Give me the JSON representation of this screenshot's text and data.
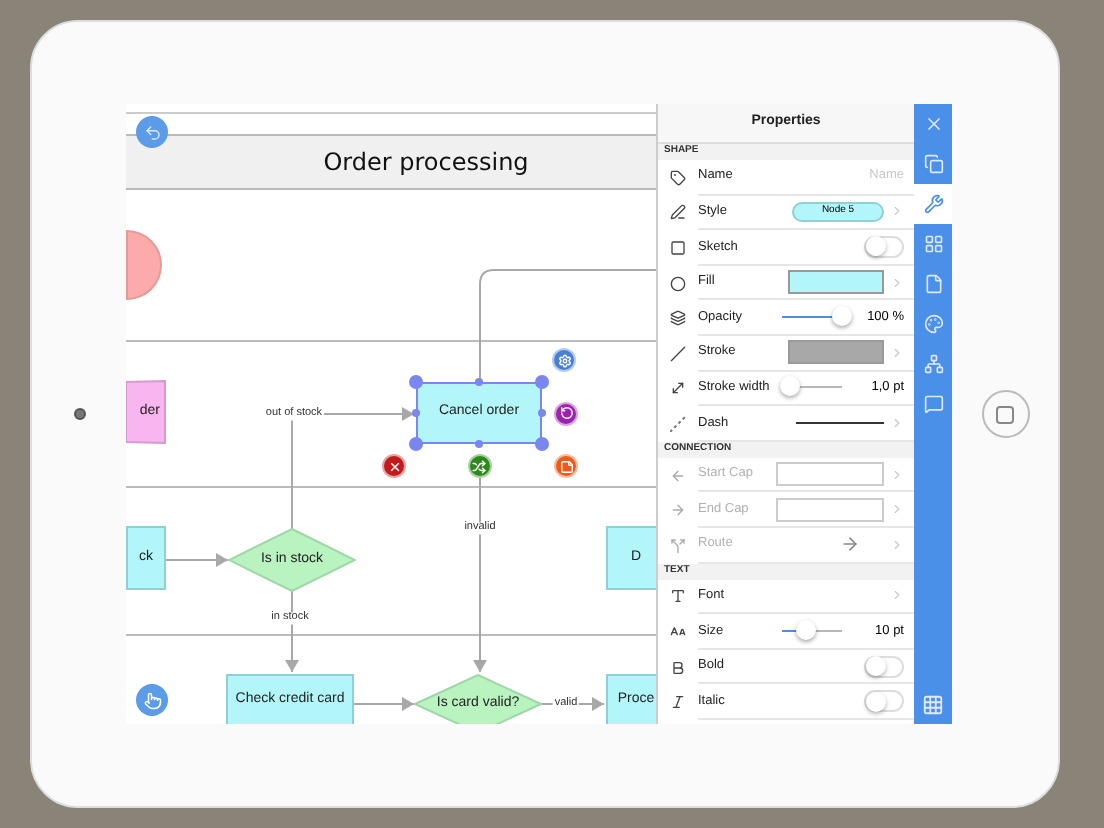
{
  "canvas": {
    "title": "Order processing",
    "nodes": [
      {
        "kind": "manual",
        "text": "der",
        "selected": false
      },
      {
        "kind": "process",
        "text": "Cancel order",
        "selected": true
      },
      {
        "kind": "process",
        "text": "ck",
        "selected": false
      },
      {
        "kind": "decision",
        "text": "Is in stock",
        "selected": false
      },
      {
        "kind": "process",
        "text": "D",
        "selected": false
      },
      {
        "kind": "process",
        "text": "Check credit card",
        "selected": false
      },
      {
        "kind": "decision",
        "text": "Is card valid?",
        "selected": false
      },
      {
        "kind": "process",
        "text": "Proce",
        "selected": false
      }
    ],
    "edge_labels": [
      "out of stock",
      "invalid",
      "in stock",
      "valid"
    ]
  },
  "panel": {
    "title": "Properties",
    "sections": [
      {
        "label": "SHAPE",
        "rows": [
          {
            "kind": "text",
            "label": "Name",
            "placeholder": "Name",
            "disabled": false
          },
          {
            "kind": "style",
            "label": "Style",
            "value": "Node 5",
            "disabled": false
          },
          {
            "kind": "toggle",
            "label": "Sketch",
            "on": false,
            "disabled": false
          },
          {
            "kind": "color",
            "label": "Fill",
            "color": "#b3f6fa",
            "disabled": false
          },
          {
            "kind": "slider",
            "label": "Opacity",
            "level": 1,
            "reading": "100 %",
            "disabled": false
          },
          {
            "kind": "color",
            "label": "Stroke",
            "color": "#a8a8a8",
            "disabled": false
          },
          {
            "kind": "slider",
            "label": "Stroke width",
            "level": 0.12,
            "reading": "1,0 pt",
            "disabled": false
          },
          {
            "kind": "dash",
            "label": "Dash",
            "disabled": false
          }
        ]
      },
      {
        "label": "CONNECTION",
        "rows": [
          {
            "kind": "field",
            "label": "Start Cap",
            "disabled": true
          },
          {
            "kind": "field",
            "label": "End Cap",
            "disabled": true
          },
          {
            "kind": "route",
            "label": "Route",
            "disabled": true
          }
        ]
      },
      {
        "label": "TEXT",
        "rows": [
          {
            "kind": "link",
            "label": "Font",
            "disabled": false
          },
          {
            "kind": "slider",
            "label": "Size",
            "level": 0.4,
            "reading": "10 pt",
            "disabled": false
          },
          {
            "kind": "toggle",
            "label": "Bold",
            "on": false,
            "disabled": false
          },
          {
            "kind": "toggle",
            "label": "Italic",
            "on": false,
            "disabled": false
          }
        ]
      }
    ]
  },
  "sidebar": {
    "items": [
      {
        "selected": false
      },
      {
        "selected": false
      },
      {
        "selected": true
      },
      {
        "selected": false
      },
      {
        "selected": false
      },
      {
        "selected": false
      },
      {
        "selected": false
      },
      {
        "selected": false
      }
    ]
  }
}
